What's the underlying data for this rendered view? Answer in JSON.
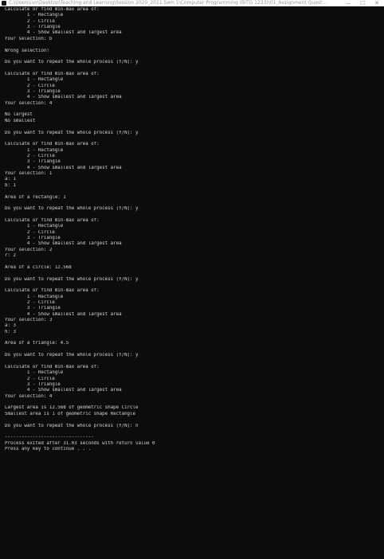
{
  "window": {
    "title": "C:\\Users\\ivo\\Desktop\\Teaching and Learning\\Session 2020_2021 Sem 1\\Computer Programming (BITG 1233)\\01_Assignment Quest...",
    "minimize_glyph": "—",
    "maximize_glyph": "☐",
    "close_glyph": "✕"
  },
  "console": {
    "lines": [
      "Calculate or find min-max area of:",
      "        1 - Rectangle",
      "        2 - Circle",
      "        3 - Triangle",
      "        4 - Show smallest and largest area",
      "Your selection: b",
      "",
      "Wrong selection!",
      "",
      "Do you want to repeat the whole process (Y/N): y",
      "",
      "Calculate or find min-max area of:",
      "        1 - Rectangle",
      "        2 - Circle",
      "        3 - Triangle",
      "        4 - Show smallest and largest area",
      "Your selection: 4",
      "",
      "No largest",
      "No smallest",
      "",
      "Do you want to repeat the whole process (Y/N): y",
      "",
      "Calculate or find min-max area of:",
      "        1 - Rectangle",
      "        2 - Circle",
      "        3 - Triangle",
      "        4 - Show smallest and largest area",
      "Your selection: 1",
      "a: 1",
      "b: 1",
      "",
      "Area of a rectangle: 1",
      "",
      "Do you want to repeat the whole process (Y/N): y",
      "",
      "Calculate or find min-max area of:",
      "        1 - Rectangle",
      "        2 - Circle",
      "        3 - Triangle",
      "        4 - Show smallest and largest area",
      "Your selection: 2",
      "r: 2",
      "",
      "Area of a circle: 12.568",
      "",
      "Do you want to repeat the whole process (Y/N): y",
      "",
      "Calculate or find min-max area of:",
      "        1 - Rectangle",
      "        2 - Circle",
      "        3 - Triangle",
      "        4 - Show smallest and largest area",
      "Your selection: 3",
      "a: 3",
      "h: 3",
      "",
      "Area of a triangle: 4.5",
      "",
      "Do you want to repeat the whole process (Y/N): y",
      "",
      "Calculate or find min-max area of:",
      "        1 - Rectangle",
      "        2 - Circle",
      "        3 - Triangle",
      "        4 - Show smallest and largest area",
      "Your selection: 4",
      "",
      "Largest area is 12.568 of geometric shape Circle",
      "Smallest area is 1 of geometric shape Rectangle",
      "",
      "Do you want to repeat the whole process (Y/N): n",
      "",
      "--------------------------------",
      "Process exited after 31.03 seconds with return value 0",
      "Press any key to continue . . ."
    ]
  }
}
